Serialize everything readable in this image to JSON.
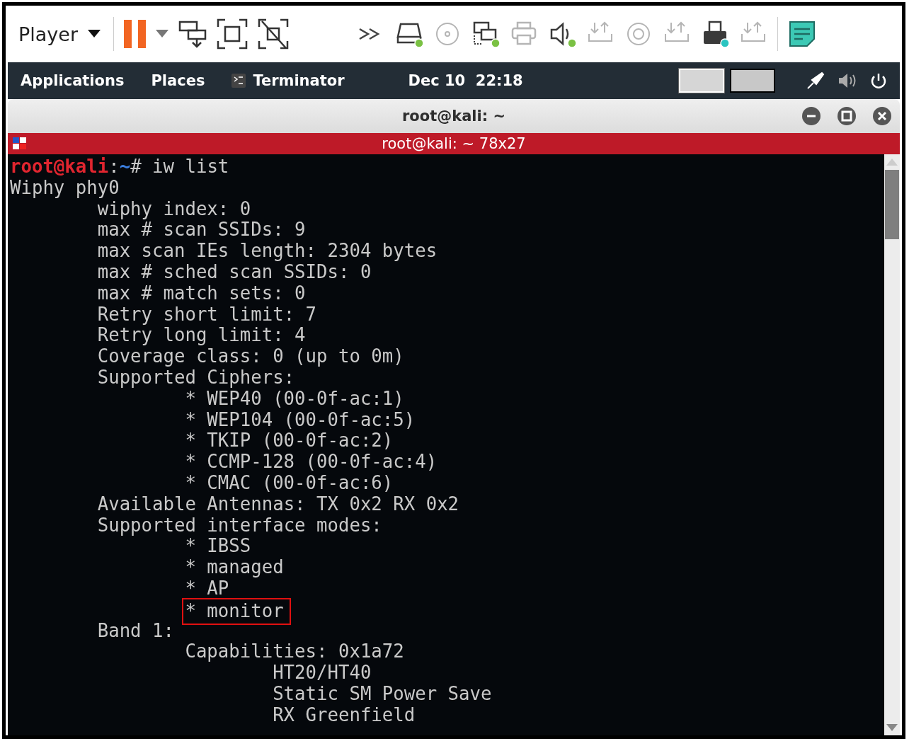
{
  "player_toolbar": {
    "menu": "Player",
    "paused": true,
    "devices": [
      {
        "kind": "drive",
        "active": true
      },
      {
        "kind": "disc",
        "active": false
      },
      {
        "kind": "network",
        "active": true
      },
      {
        "kind": "printer",
        "active": false
      },
      {
        "kind": "speaker",
        "active": true
      },
      {
        "kind": "usb",
        "active": false
      },
      {
        "kind": "camera",
        "active": false
      },
      {
        "kind": "usb",
        "active": false
      },
      {
        "kind": "card",
        "active": true
      },
      {
        "kind": "usb",
        "active": false
      }
    ]
  },
  "top_bar": {
    "menus": [
      "Applications",
      "Places"
    ],
    "app": "Terminator",
    "clock": "Dec 10  22:18",
    "workspaces": [
      {
        "selected": true
      },
      {
        "selected": false
      }
    ]
  },
  "window": {
    "title": "root@kali: ~",
    "tab_title": "root@kali: ~ 78x27"
  },
  "terminal": {
    "prompt": {
      "user": "root@kali",
      "separator": ":",
      "path": "~",
      "command": "# iw list"
    },
    "output": [
      {
        "text": "Wiphy phy0",
        "children": [
          {
            "text": "wiphy index: 0"
          },
          {
            "text": "max # scan SSIDs: 9"
          },
          {
            "text": "max scan IEs length: 2304 bytes"
          },
          {
            "text": "max # sched scan SSIDs: 0"
          },
          {
            "text": "max # match sets: 0"
          },
          {
            "text": "Retry short limit: 7"
          },
          {
            "text": "Retry long limit: 4"
          },
          {
            "text": "Coverage class: 0 (up to 0m)"
          },
          {
            "text": "Supported Ciphers:",
            "children": [
              {
                "text": "* WEP40 (00-0f-ac:1)"
              },
              {
                "text": "* WEP104 (00-0f-ac:5)"
              },
              {
                "text": "* TKIP (00-0f-ac:2)"
              },
              {
                "text": "* CCMP-128 (00-0f-ac:4)"
              },
              {
                "text": "* CMAC (00-0f-ac:6)"
              }
            ]
          },
          {
            "text": "Available Antennas: TX 0x2 RX 0x2"
          },
          {
            "text": "Supported interface modes:",
            "children": [
              {
                "text": "* IBSS",
                "highlighted": false
              },
              {
                "text": "* managed",
                "highlighted": false
              },
              {
                "text": "* AP",
                "highlighted": false
              },
              {
                "text": "* monitor",
                "highlighted": true
              }
            ]
          },
          {
            "text": "Band 1:",
            "children": [
              {
                "text": "Capabilities: 0x1a72",
                "children": [
                  {
                    "text": "HT20/HT40"
                  },
                  {
                    "text": "Static SM Power Save"
                  },
                  {
                    "text": "RX Greenfield"
                  }
                ]
              }
            ]
          }
        ]
      }
    ]
  }
}
